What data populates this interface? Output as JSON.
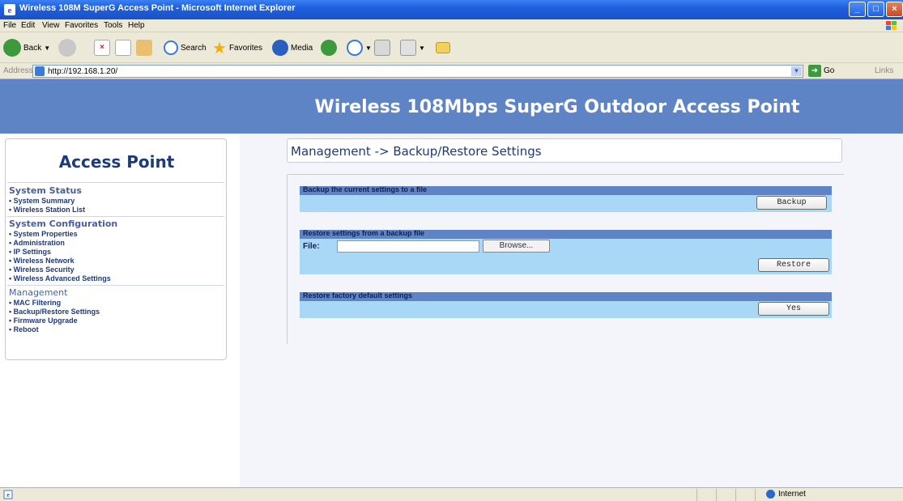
{
  "window": {
    "title": "Wireless 108M SuperG Access Point - Microsoft Internet Explorer"
  },
  "menu": [
    "File",
    "Edit",
    "View",
    "Favorites",
    "Tools",
    "Help"
  ],
  "toolbar": {
    "back": "Back",
    "search": "Search",
    "favorites": "Favorites",
    "media": "Media"
  },
  "address": {
    "label": "Address",
    "url": "http://192.168.1.20/",
    "go": "Go",
    "links": "Links"
  },
  "banner": {
    "title": "Wireless 108Mbps SuperG Outdoor Access Point"
  },
  "nav": {
    "heading": "Access Point",
    "sections": [
      {
        "title": "System Status",
        "items": [
          "System Summary",
          "Wireless Station List"
        ]
      },
      {
        "title": "System Configuration",
        "items": [
          "System Properties",
          "Administration",
          "IP Settings",
          "Wireless Network",
          "Wireless Security",
          "Wireless Advanced Settings"
        ]
      },
      {
        "title": "Management",
        "items": [
          "MAC Filtering",
          "Backup/Restore Settings",
          "Firmware Upgrade",
          "Reboot"
        ]
      }
    ]
  },
  "main": {
    "breadcrumb": "Management -> Backup/Restore Settings",
    "backup": {
      "header": "Backup the current settings to a file",
      "button": "Backup"
    },
    "restore": {
      "header": "Restore settings from a backup file",
      "file_label": "File:",
      "file_value": "",
      "browse": "Browse...",
      "button": "Restore"
    },
    "factory": {
      "header": "Restore factory default settings",
      "button": "Yes"
    }
  },
  "status": {
    "zone": "Internet"
  },
  "colors": {
    "banner": "#5f84c6",
    "panel": "#a8d8f5",
    "nav_text": "#1f3a7a"
  }
}
